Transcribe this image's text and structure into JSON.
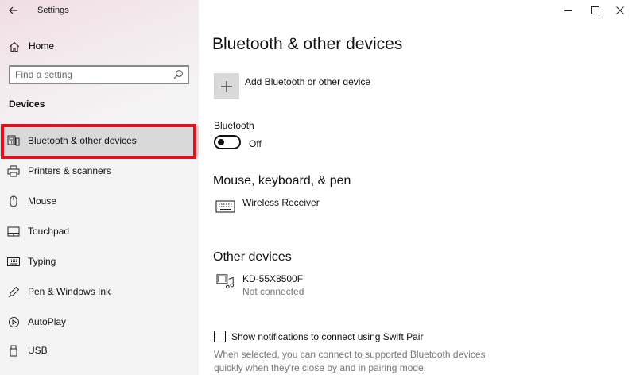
{
  "window": {
    "title": "Settings"
  },
  "sidebar": {
    "home_label": "Home",
    "search_placeholder": "Find a setting",
    "section_heading": "Devices",
    "items": [
      {
        "label": "Bluetooth & other devices",
        "icon": "bluetooth-devices-icon",
        "selected": true
      },
      {
        "label": "Printers & scanners",
        "icon": "printer-icon"
      },
      {
        "label": "Mouse",
        "icon": "mouse-icon"
      },
      {
        "label": "Touchpad",
        "icon": "touchpad-icon"
      },
      {
        "label": "Typing",
        "icon": "keyboard-icon"
      },
      {
        "label": "Pen & Windows Ink",
        "icon": "pen-icon"
      },
      {
        "label": "AutoPlay",
        "icon": "autoplay-icon"
      },
      {
        "label": "USB",
        "icon": "usb-icon"
      }
    ],
    "highlight_color": "#e0131e"
  },
  "main": {
    "title": "Bluetooth & other devices",
    "add_device_label": "Add Bluetooth or other device",
    "bluetooth": {
      "label": "Bluetooth",
      "state": "Off",
      "on": false
    },
    "mouse_section": {
      "title": "Mouse, keyboard, & pen",
      "devices": [
        {
          "name": "Wireless Receiver",
          "icon": "keyboard-icon"
        }
      ]
    },
    "other_section": {
      "title": "Other devices",
      "devices": [
        {
          "name": "KD-55X8500F",
          "status": "Not connected",
          "icon": "media-device-icon"
        }
      ]
    },
    "swift_pair": {
      "label": "Show notifications to connect using Swift Pair",
      "checked": false,
      "description": "When selected, you can connect to supported Bluetooth devices quickly when they're close by and in pairing mode."
    }
  }
}
